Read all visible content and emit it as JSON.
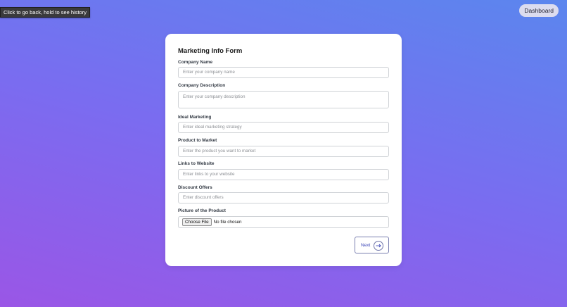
{
  "tooltip": {
    "text": "Click to go back, hold to see history"
  },
  "header": {
    "dashboard_label": "Dashboard"
  },
  "form": {
    "title": "Marketing Info Form",
    "fields": [
      {
        "label": "Company Name",
        "placeholder": "Enter your company name",
        "type": "text"
      },
      {
        "label": "Company Description",
        "placeholder": "Enter your company description",
        "type": "textarea"
      },
      {
        "label": "Ideal Marketing",
        "placeholder": "Enter ideal marketing strategy",
        "type": "text"
      },
      {
        "label": "Product to Market",
        "placeholder": "Enter the product you want to market",
        "type": "text"
      },
      {
        "label": "Links to Website",
        "placeholder": "Enter links to your website",
        "type": "text"
      },
      {
        "label": "Discount Offers",
        "placeholder": "Enter discount offers",
        "type": "text"
      }
    ],
    "file": {
      "label": "Picture of the Product",
      "button_label": "Choose File",
      "status": "No file chosen"
    },
    "next_label": "Next",
    "next_icon": "arrow-right-icon"
  },
  "colors": {
    "accent": "#3b46b8",
    "background_start": "#9a56e6",
    "background_end": "#5b86ee"
  }
}
